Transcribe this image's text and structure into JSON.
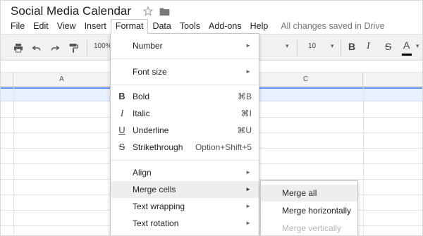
{
  "document": {
    "title": "Social Media Calendar",
    "save_status": "All changes saved in Drive"
  },
  "menubar": {
    "items": [
      {
        "label": "File"
      },
      {
        "label": "Edit"
      },
      {
        "label": "View"
      },
      {
        "label": "Insert"
      },
      {
        "label": "Format",
        "active": true
      },
      {
        "label": "Data"
      },
      {
        "label": "Tools"
      },
      {
        "label": "Add-ons"
      },
      {
        "label": "Help"
      }
    ]
  },
  "toolbar": {
    "zoom": "100%",
    "font_size": "10",
    "icons": [
      "print-icon",
      "undo-icon",
      "redo-icon",
      "paint-format-icon",
      "bold-icon",
      "italic-icon",
      "strikethrough-icon",
      "text-color-icon"
    ]
  },
  "grid": {
    "columns": [
      "A",
      "C"
    ]
  },
  "format_menu": {
    "number": "Number",
    "font_size": "Font size",
    "bold": "Bold",
    "bold_shortcut": "⌘B",
    "italic": "Italic",
    "italic_shortcut": "⌘I",
    "underline": "Underline",
    "underline_shortcut": "⌘U",
    "strikethrough": "Strikethrough",
    "strikethrough_shortcut": "Option+Shift+5",
    "align": "Align",
    "merge_cells": "Merge cells",
    "text_wrapping": "Text wrapping",
    "text_rotation": "Text rotation",
    "arrow": "►"
  },
  "merge_submenu": {
    "merge_all": "Merge all",
    "merge_horizontally": "Merge horizontally",
    "merge_vertically": "Merge vertically"
  },
  "colors": {
    "selection_fill": "#e8f0fe",
    "selection_border": "#5b8ff3",
    "toolbar_bg": "#f1f1f1",
    "menu_hover": "#eeeeee",
    "disabled_text": "#b5b5b5"
  }
}
